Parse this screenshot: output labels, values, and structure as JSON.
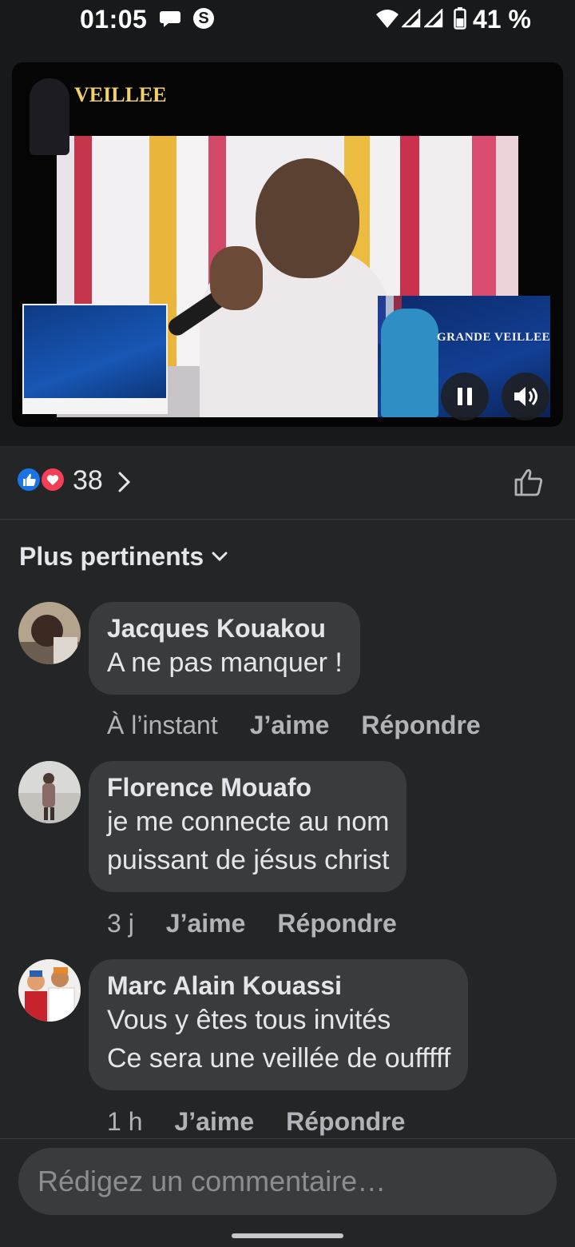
{
  "status_bar": {
    "time": "01:05",
    "s_badge": "S",
    "battery": "41 %"
  },
  "video": {
    "left_flyer_title": "VEILLEE",
    "right_flyer_title": "GRANDE VEILLEE"
  },
  "reactions": {
    "count": "38"
  },
  "sort": {
    "label": "Plus pertinents"
  },
  "comments": [
    {
      "author": "Jacques Kouakou",
      "text": "A ne pas manquer !",
      "time": "À l’instant",
      "like_label": "J’aime",
      "reply_label": "Répondre"
    },
    {
      "author": "Florence Mouafo",
      "text": "je me connecte au nom\npuissant de jésus christ",
      "time": "3 j",
      "like_label": "J’aime",
      "reply_label": "Répondre"
    },
    {
      "author": "Marc Alain Kouassi",
      "text": "Vous y êtes tous invités\nCe sera une veillée de oufffff",
      "time": "1 h",
      "like_label": "J’aime",
      "reply_label": "Répondre"
    }
  ],
  "compose": {
    "placeholder": "Rédigez un commentaire…"
  },
  "colors": {
    "background": "#242526",
    "bubble": "#3a3b3c",
    "like_blue": "#1b74e4",
    "love_red": "#f33e58",
    "secondary_text": "#b0b3b8"
  },
  "icons": [
    "chat-bubble-icon",
    "s-app-icon",
    "wifi-icon",
    "signal-icon",
    "battery-icon",
    "pause-icon",
    "volume-icon",
    "like-reaction-icon",
    "love-reaction-icon",
    "chevron-right-icon",
    "thumbs-up-outline-icon",
    "chevron-down-icon"
  ]
}
